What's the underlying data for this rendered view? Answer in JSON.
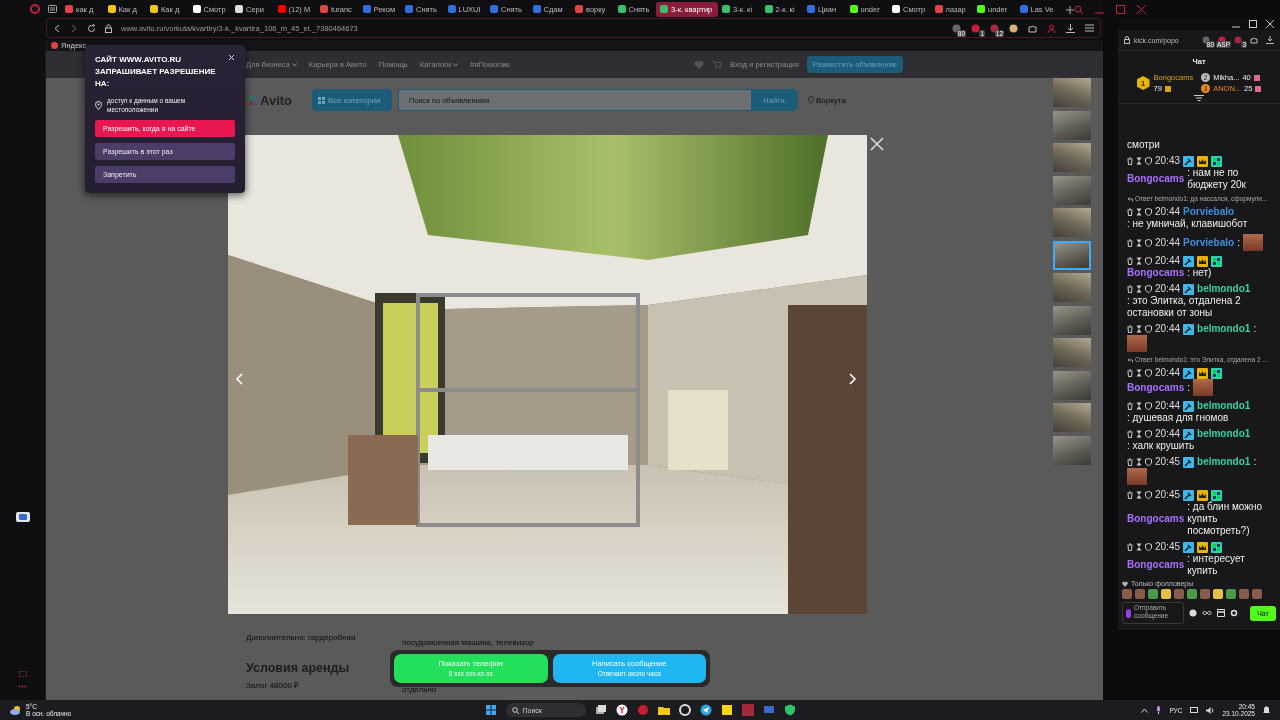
{
  "browser": {
    "tabs": [
      {
        "label": "как д",
        "selected": false,
        "color": "#e04444"
      },
      {
        "label": "Как д",
        "selected": false,
        "color": "#f5c518"
      },
      {
        "label": "Как д",
        "selected": false,
        "color": "#f5c518"
      },
      {
        "label": "Смотр",
        "selected": false,
        "color": "#ffffff"
      },
      {
        "label": "Сери",
        "selected": false,
        "color": "#dddddd"
      },
      {
        "label": "(12) M",
        "selected": false,
        "color": "#ff0000"
      },
      {
        "label": "turanc",
        "selected": false,
        "color": "#e04444"
      },
      {
        "label": "Реком",
        "selected": false,
        "color": "#2f6fe0"
      },
      {
        "label": "Снять",
        "selected": false,
        "color": "#2f6fe0"
      },
      {
        "label": "LUXUI",
        "selected": false,
        "color": "#2f6fe0"
      },
      {
        "label": "Снять",
        "selected": false,
        "color": "#2f6fe0"
      },
      {
        "label": "Сдам",
        "selected": false,
        "color": "#2f6fe0"
      },
      {
        "label": "ворку",
        "selected": false,
        "color": "#e04444"
      },
      {
        "label": "Снять",
        "selected": false,
        "color": "#38c06a"
      },
      {
        "label": "3-к. квартир",
        "selected": true,
        "color": "#38c06a"
      },
      {
        "label": "3-к. кі",
        "selected": false,
        "color": "#38c06a"
      },
      {
        "label": "2-к. кі",
        "selected": false,
        "color": "#38c06a"
      },
      {
        "label": "Циан",
        "selected": false,
        "color": "#2f6fe0"
      },
      {
        "label": "under",
        "selected": false,
        "color": "#53fc18"
      },
      {
        "label": "Смотр",
        "selected": false,
        "color": "#ffffff"
      },
      {
        "label": "лазар",
        "selected": false,
        "color": "#e04444"
      },
      {
        "label": "under",
        "selected": false,
        "color": "#53fc18"
      },
      {
        "label": "Las Ve",
        "selected": false,
        "color": "#2f6fe0"
      }
    ],
    "url": "www.avito.ru/vorkuta/kvartiry/3-k._kvartira_106_m_45_et._7380464673",
    "extension_badges": [
      "80",
      "1",
      "12"
    ],
    "bookmark": "Яндекс"
  },
  "popup": {
    "title": "САЙТ WWW.AVITO.RU ЗАПРАШИВАЕТ РАЗРЕШЕНИЕ НА:",
    "permission": "доступ к данным о вашем местоположении",
    "buttons": [
      "Разрешить, когда я на сайте",
      "Разрешить в этот раз",
      "Запретить"
    ]
  },
  "avito": {
    "nav": [
      "Для бизнеса",
      "Карьера в Авито",
      "Помощь",
      "Каталоги",
      "#яПомогаю"
    ],
    "login": "Вход и регистрация",
    "post_button": "Разместить объявление",
    "logo": "Avito",
    "categories_button": "Все категории",
    "search": {
      "placeholder": "Поиск по объявлениям"
    },
    "find_button": "Найти",
    "city": "Воркута",
    "details": [
      {
        "text": "Дополнительно: гардеробная"
      },
      {
        "text": "посудомоечная машина, телевизор"
      }
    ],
    "section_title": "Условия аренды",
    "deposit": "Залог  48000 ₽",
    "column_2": "отдельно",
    "contact": [
      {
        "label": "Показать телефон",
        "sub": "8 ххх ххх-хх-хх"
      },
      {
        "label": "Написать сообщение",
        "sub": "Отвечает около часа"
      }
    ]
  },
  "gallery": {
    "thumbnails": [
      {
        "selected": false
      },
      {
        "selected": false
      },
      {
        "selected": false
      },
      {
        "selected": false
      },
      {
        "selected": false
      },
      {
        "selected": true
      },
      {
        "selected": false
      },
      {
        "selected": false
      },
      {
        "selected": false
      },
      {
        "selected": false
      },
      {
        "selected": false
      },
      {
        "selected": false
      }
    ]
  },
  "chat": {
    "address": "kick.com/popo",
    "extension_badges": [
      "80",
      "ASP",
      "3"
    ],
    "title": "Чат",
    "leaders": [
      {
        "rank": "1",
        "name": "Bongocams",
        "count": "79"
      },
      {
        "rank": "2",
        "name": "Mikha...",
        "count": "40"
      },
      {
        "rank": "3",
        "name": "ANON...",
        "count": "25"
      }
    ],
    "messages": [
      {
        "kind": "fragment",
        "text": "смотри"
      },
      {
        "kind": "text",
        "time": "20:43",
        "moderator": true,
        "vip": true,
        "subscriber": true,
        "user": "Bongocams",
        "color": "#a970ff",
        "text": ": нам не по бюджету 20к"
      },
      {
        "kind": "reply",
        "text": "Ответ belmondo1: да нассался, сформули..."
      },
      {
        "kind": "text",
        "time": "20:44",
        "moderator": false,
        "vip": false,
        "subscriber": false,
        "user": "Porviebalo",
        "color": "#3d8fe0",
        "text": ": не умничай, клавишобот"
      },
      {
        "kind": "emote",
        "time": "20:44",
        "moderator": false,
        "vip": false,
        "subscriber": false,
        "user": "Porviebalo",
        "color": "#3d8fe0",
        "text": ":"
      },
      {
        "kind": "text",
        "time": "20:44",
        "moderator": true,
        "vip": true,
        "subscriber": true,
        "user": "Bongocams",
        "color": "#a970ff",
        "text": ": нет)"
      },
      {
        "kind": "text",
        "time": "20:44",
        "moderator": true,
        "vip": false,
        "subscriber": false,
        "user": "belmondo1",
        "color": "#2ed3a0",
        "text": ": это Элитка, отдалена 2 остановки от зоны"
      },
      {
        "kind": "emote",
        "time": "20:44",
        "moderator": true,
        "vip": false,
        "subscriber": false,
        "user": "belmondo1",
        "color": "#2ed3a0",
        "text": ":"
      },
      {
        "kind": "reply",
        "text": "Ответ belmondo1: это Элитка, отдалена 2 ..."
      },
      {
        "kind": "emote",
        "time": "20:44",
        "moderator": true,
        "vip": true,
        "subscriber": true,
        "user": "Bongocams",
        "color": "#a970ff",
        "text": ":"
      },
      {
        "kind": "text",
        "time": "20:44",
        "moderator": true,
        "vip": false,
        "subscriber": false,
        "user": "belmondo1",
        "color": "#2ed3a0",
        "text": ": душевая для гномов"
      },
      {
        "kind": "text",
        "time": "20:44",
        "moderator": true,
        "vip": false,
        "subscriber": false,
        "user": "belmondo1",
        "color": "#2ed3a0",
        "text": ": халк крушить"
      },
      {
        "kind": "emote",
        "time": "20:45",
        "moderator": true,
        "vip": false,
        "subscriber": false,
        "user": "belmondo1",
        "color": "#2ed3a0",
        "text": ":"
      },
      {
        "kind": "text",
        "time": "20:45",
        "moderator": true,
        "vip": true,
        "subscriber": true,
        "user": "Bongocams",
        "color": "#a970ff",
        "text": ": да блин можно купить посмотреть?)"
      },
      {
        "kind": "text",
        "time": "20:45",
        "moderator": true,
        "vip": true,
        "subscriber": true,
        "user": "Bongocams",
        "color": "#a970ff",
        "text": ": интересует купить"
      }
    ],
    "followers_only": "Только фолловеры",
    "input": {
      "placeholder": "Отправить сообщение"
    },
    "send_button": "Чат"
  },
  "taskbar": {
    "temperature": "5°C",
    "weather": "В осн. облачно",
    "search": {
      "placeholder": "Поиск"
    },
    "language": "РУС",
    "time": "20:45",
    "date": "23.10.2025"
  }
}
